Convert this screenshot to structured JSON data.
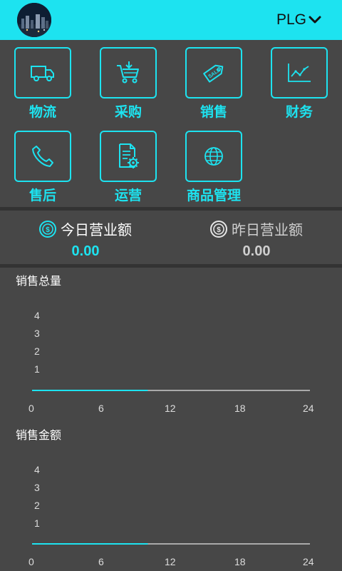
{
  "header": {
    "brand": "PLG"
  },
  "menu": [
    {
      "label": "物流",
      "icon": "truck-icon"
    },
    {
      "label": "采购",
      "icon": "cart-icon"
    },
    {
      "label": "销售",
      "icon": "sale-tag-icon"
    },
    {
      "label": "财务",
      "icon": "line-chart-icon"
    },
    {
      "label": "售后",
      "icon": "phone-icon"
    },
    {
      "label": "运营",
      "icon": "document-gear-icon"
    },
    {
      "label": "商品管理",
      "icon": "globe-icon"
    }
  ],
  "revenue": {
    "today_label": "今日营业额",
    "today_value": "0.00",
    "yesterday_label": "昨日营业额",
    "yesterday_value": "0.00"
  },
  "chart_data": [
    {
      "type": "line",
      "title": "销售总量",
      "x_ticks": [
        "0",
        "6",
        "12",
        "18",
        "24"
      ],
      "y_ticks": [
        "1",
        "2",
        "3",
        "4"
      ],
      "series": [
        {
          "x": [
            0,
            10,
            24
          ],
          "y": [
            0,
            0,
            0
          ]
        }
      ],
      "highlight_range": [
        0,
        10
      ],
      "colors": {
        "highlight": "#1de3f0",
        "line": "#aaaaaa"
      }
    },
    {
      "type": "line",
      "title": "销售金额",
      "x_ticks": [
        "0",
        "6",
        "12",
        "18",
        "24"
      ],
      "y_ticks": [
        "1",
        "2",
        "3",
        "4"
      ],
      "series": [
        {
          "x": [
            0,
            10,
            24
          ],
          "y": [
            0,
            0,
            0
          ]
        }
      ],
      "highlight_range": [
        0,
        10
      ],
      "colors": {
        "highlight": "#1de3f0",
        "line": "#aaaaaa"
      }
    }
  ],
  "colors": {
    "accent": "#1de3f0",
    "background": "#474747",
    "divider": "#333333"
  }
}
